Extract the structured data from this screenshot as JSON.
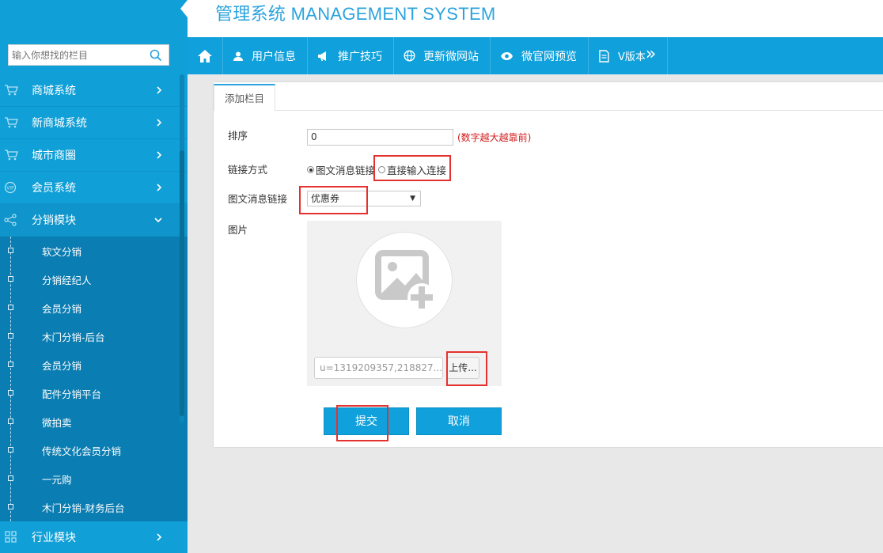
{
  "header": {
    "title": "管理系统 MANAGEMENT SYSTEM"
  },
  "search": {
    "placeholder": "输入你想找的栏目"
  },
  "sidebar": {
    "items": [
      {
        "label": "商城系统",
        "icon": "cart-icon"
      },
      {
        "label": "新商城系统",
        "icon": "cart-icon"
      },
      {
        "label": "城市商圈",
        "icon": "cart-icon"
      },
      {
        "label": "会员系统",
        "icon": "vip-icon"
      },
      {
        "label": "分销模块",
        "icon": "share-icon",
        "expanded": true
      },
      {
        "label": "行业模块",
        "icon": "grid-icon"
      }
    ],
    "sub_items": [
      "软文分销",
      "分销经纪人",
      "会员分销",
      "木门分销-后台",
      "会员分销",
      "配件分销平台",
      "微拍卖",
      "传统文化会员分销",
      "一元购",
      "木门分销-财务后台"
    ]
  },
  "topnav": {
    "items": [
      {
        "label": "用户信息",
        "icon": "user-icon"
      },
      {
        "label": "推广技巧",
        "icon": "megaphone-icon"
      },
      {
        "label": "更新微网站",
        "icon": "globe-icon"
      },
      {
        "label": "微官网预览",
        "icon": "eye-icon"
      },
      {
        "label": "V版本",
        "icon": "document-icon"
      }
    ],
    "more": "»"
  },
  "tab": {
    "label": "添加栏目"
  },
  "form": {
    "order_label": "排序",
    "order_value": "0",
    "order_hint": "(数字越大越靠前)",
    "link_type_label": "链接方式",
    "link_type_options": [
      "图文消息链接",
      "直接输入连接"
    ],
    "link_type_selected": "图文消息链接",
    "msg_link_label": "图文消息链接",
    "msg_link_value": "优惠券",
    "msg_link_arrow": "▼",
    "image_label": "图片",
    "file_name": "u=1319209357,218827...",
    "upload_label": "上传...",
    "submit_label": "提交",
    "cancel_label": "取消"
  },
  "colors": {
    "brand_blue": "#10a0db",
    "sidebar_sub": "#0a7db2",
    "hint_red": "#d21a1a",
    "highlight_red": "#e4312f"
  }
}
